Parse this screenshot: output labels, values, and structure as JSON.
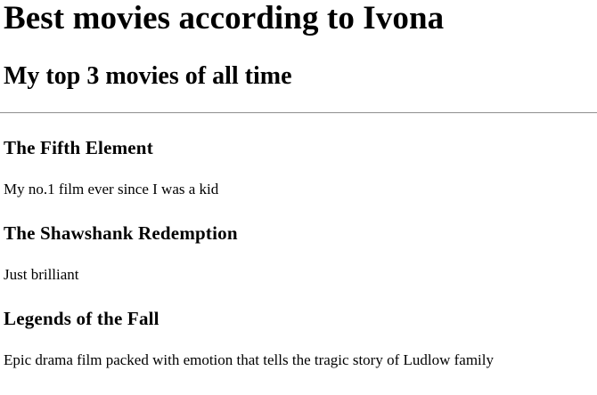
{
  "page": {
    "title": "Best movies according to Ivona",
    "subtitle": "My top 3 movies of all time"
  },
  "movies": [
    {
      "title": "The Fifth Element",
      "description": "My no.1 film ever since I was a kid"
    },
    {
      "title": "The Shawshank Redemption",
      "description": "Just brilliant"
    },
    {
      "title": "Legends of the Fall",
      "description": "Epic drama film packed with emotion that tells the tragic story of Ludlow family"
    }
  ]
}
